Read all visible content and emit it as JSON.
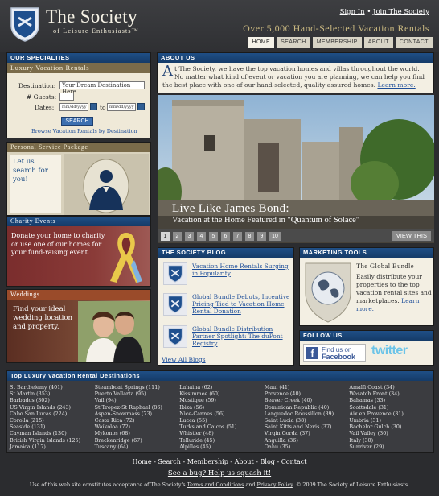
{
  "header": {
    "title": "The Society",
    "subtitle": "of Leisure Enthusiasts™",
    "tagline": "Over 5,000 Hand-Selected Vacation Rentals",
    "sign_in": "Sign In",
    "separator": "•",
    "join": "Join The Society",
    "tabs": [
      "HOME",
      "SEARCH",
      "MEMBERSHIP",
      "ABOUT",
      "CONTACT"
    ]
  },
  "specialties": {
    "heading": "Our Specialties",
    "subheading": "Luxury Vacation Rentals",
    "destination_label": "Destination:",
    "destination_value": "Your Dream Destination Here",
    "guests_label": "# Guests:",
    "dates_label": "Dates:",
    "date_placeholder": "mm/dd/yyyy",
    "to_label": "to",
    "search_button": "Search",
    "browse_link": "Browse Vacation Rentals by Destination"
  },
  "personal_service": {
    "heading": "Personal Service Package",
    "text": "Let us search for you!"
  },
  "charity": {
    "heading": "Charity Events",
    "text": "Donate your home to charity or use one of our homes for your fund-raising event."
  },
  "weddings": {
    "heading": "Weddings",
    "text": "Find your ideal wedding location and property."
  },
  "about": {
    "heading": "About Us",
    "drop_cap": "A",
    "text": "t The Society, we have the top vacation homes and villas throughout the world. No matter what kind of event or vacation you are planning, we can help you find the best place with one of our hand-selected, quality assured homes.",
    "learn_more": "Learn more."
  },
  "hero": {
    "title": "Live Like James Bond:",
    "subtitle": "Vacation at the Home Featured in \"Quantum of Solace\"",
    "pages": [
      "1",
      "2",
      "3",
      "4",
      "5",
      "6",
      "7",
      "8",
      "9",
      "10"
    ],
    "active_page": "1",
    "view_this": "VIEW THIS"
  },
  "blog": {
    "heading": "The Society Blog",
    "posts": [
      "Vacation Home Rentals Surging in Popularity",
      "Global Bundle Debuts, Incentive Pricing Tied to Vacation Home Rental Donation",
      "Global Bundle Distribution Partner Spotlight: The duPont Registry"
    ],
    "view_all": "View All Blogs"
  },
  "marketing": {
    "heading": "Marketing Tools",
    "title": "The Global Bundle",
    "text": "Easily distribute your properties to the top vacation rental sites and marketplaces.",
    "learn_more": "Learn more."
  },
  "follow": {
    "heading": "Follow Us",
    "facebook_line1": "Find us on",
    "facebook_line2": "Facebook",
    "twitter": "twitter"
  },
  "destinations": {
    "heading": "Top Luxury Vacation Rental Destinations",
    "columns": [
      [
        "St Barthelemy (401)",
        "St Martin (353)",
        "Barbados (302)",
        "US Virgin Islands (243)",
        "Cabo San Lucas (224)",
        "Corolla (215)",
        "Seaside (131)",
        "Cayman Islands (130)",
        "British Virgin Islands (125)",
        "Jamaica (117)"
      ],
      [
        "Steamboat Springs (111)",
        "Puerto Vallarta (95)",
        "Vail (94)",
        "St Tropez-St Raphael (86)",
        "Aspen-Snowmass (73)",
        "Costa Rica (72)",
        "Waikoloa (72)",
        "Mykonos (68)",
        "Breckenridge (67)",
        "Tuscany (64)"
      ],
      [
        "Lahaina (62)",
        "Kissimmee (60)",
        "Mustique (59)",
        "Ibiza (56)",
        "Nice-Cannes (56)",
        "Lucca (55)",
        "Turks and Caicos (51)",
        "Whistler (48)",
        "Telluride (45)",
        "Alpilles (45)"
      ],
      [
        "Maui (41)",
        "Provence (40)",
        "Beaver Creek (40)",
        "Dominican Republic (40)",
        "Languedoc Roussillon (39)",
        "Saint Lucia (38)",
        "Saint Kitts and Nevis (37)",
        "Virgin Gorda (37)",
        "Anguilla (36)",
        "Oahu (35)"
      ],
      [
        "Amalfi Coast (34)",
        "Wasatch Front (34)",
        "Bahamas (33)",
        "Scottsdale (31)",
        "Aix en Provence (31)",
        "Umbria (31)",
        "Bachelor Gulch (30)",
        "Vail Valley (30)",
        "Italy (30)",
        "Sunriver (29)"
      ]
    ]
  },
  "footer": {
    "links": [
      "Home",
      "Search",
      "Membership",
      "About",
      "Blog",
      "Contact"
    ],
    "link_separator": "-",
    "bug": "See a bug? Help us squash it!",
    "legal_prefix": "Use of this web site constitutes acceptance of The Society's",
    "terms": "Terms and Conditions",
    "and": "and",
    "privacy": "Privacy Policy",
    "legal_suffix": ". © 2009 The Society of Leisure Enthusiasts."
  },
  "colors": {
    "panel_header": "#1f4f86",
    "background": "#2b2c2f",
    "gold_text": "#c9b880",
    "link_blue": "#1f4f9a"
  },
  "icons": [
    "shield-logo-icon",
    "calendar-icon",
    "butler-icon",
    "ribbon-icon",
    "globe-icon",
    "facebook-icon",
    "twitter-icon"
  ]
}
